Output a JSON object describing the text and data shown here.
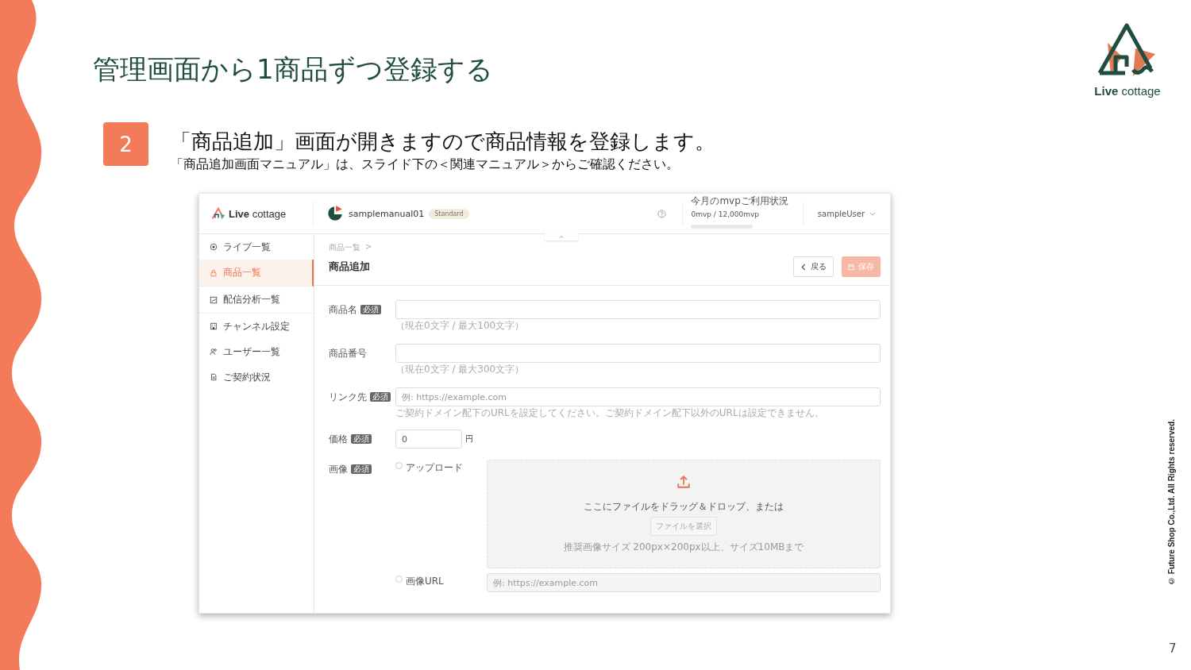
{
  "slide": {
    "title": "管理画面から1商品ずつ登録する",
    "step": "2",
    "heading": "「商品追加」画面が開きますので商品情報を登録します。",
    "subheading": "「商品追加画面マニュアル」は、スライド下の＜関連マニュアル＞からご確認ください。",
    "logo_text": "**Live** cottage",
    "copyright": "© Future Shop Co.,Ltd. All Rights reserved.",
    "page_number": "7"
  },
  "app": {
    "header": {
      "logo_text": "**Live** cottage",
      "shop_name": "samplemanual01",
      "plan_badge": "Standard",
      "usage": {
        "label": "今月のmvpご利用状況",
        "value": "0mvp / 12,000mvp",
        "level": 0
      },
      "user": "sampleUser"
    },
    "sidebar": {
      "items": [
        {
          "label": "ライブ一覧",
          "selected": false
        },
        {
          "label": "商品一覧",
          "selected": true
        },
        {
          "label": "配信分析一覧",
          "selected": false
        },
        {
          "label": "チャンネル設定",
          "selected": false
        },
        {
          "label": "ユーザー一覧",
          "selected": false
        },
        {
          "label": "ご契約状況",
          "selected": false
        }
      ]
    },
    "breadcrumb": "商品一覧",
    "breadcrumb_separator": ">",
    "page_title": "商品追加",
    "buttons": {
      "back": {
        "label": "戻る",
        "disabled": false
      },
      "save": {
        "label": "保存",
        "disabled": true
      }
    },
    "form": {
      "fields": [
        {
          "kind": "text",
          "label": "商品名",
          "required_badge": "必須",
          "hint": "（現在0文字 / 最大100文字）"
        },
        {
          "kind": "text",
          "label": "商品番号",
          "hint": "（現在0文字 / 最大300文字）"
        },
        {
          "kind": "text",
          "label": "リンク先",
          "required_badge": "必須",
          "placeholder": "例: https://example.com",
          "hint": "ご契約ドメイン配下のURLを設定してください。ご契約ドメイン配下以外のURLは設定できません。"
        },
        {
          "kind": "price",
          "label": "価格",
          "required_badge": "必須",
          "value": "0",
          "unit": "円"
        },
        {
          "kind": "image",
          "label": "画像",
          "required_badge": "必須",
          "options": [
            {
              "label": "アップロード",
              "selected": false
            },
            {
              "label": "画像URL",
              "selected": false
            }
          ],
          "drop_text": "ここにファイルをドラッグ＆ドロップ、または",
          "select_button": "ファイルを選択",
          "note": "推奨画像サイズ 200px×200px以上、サイズ10MBまで",
          "url_placeholder": "例: https://example.com"
        }
      ]
    }
  }
}
